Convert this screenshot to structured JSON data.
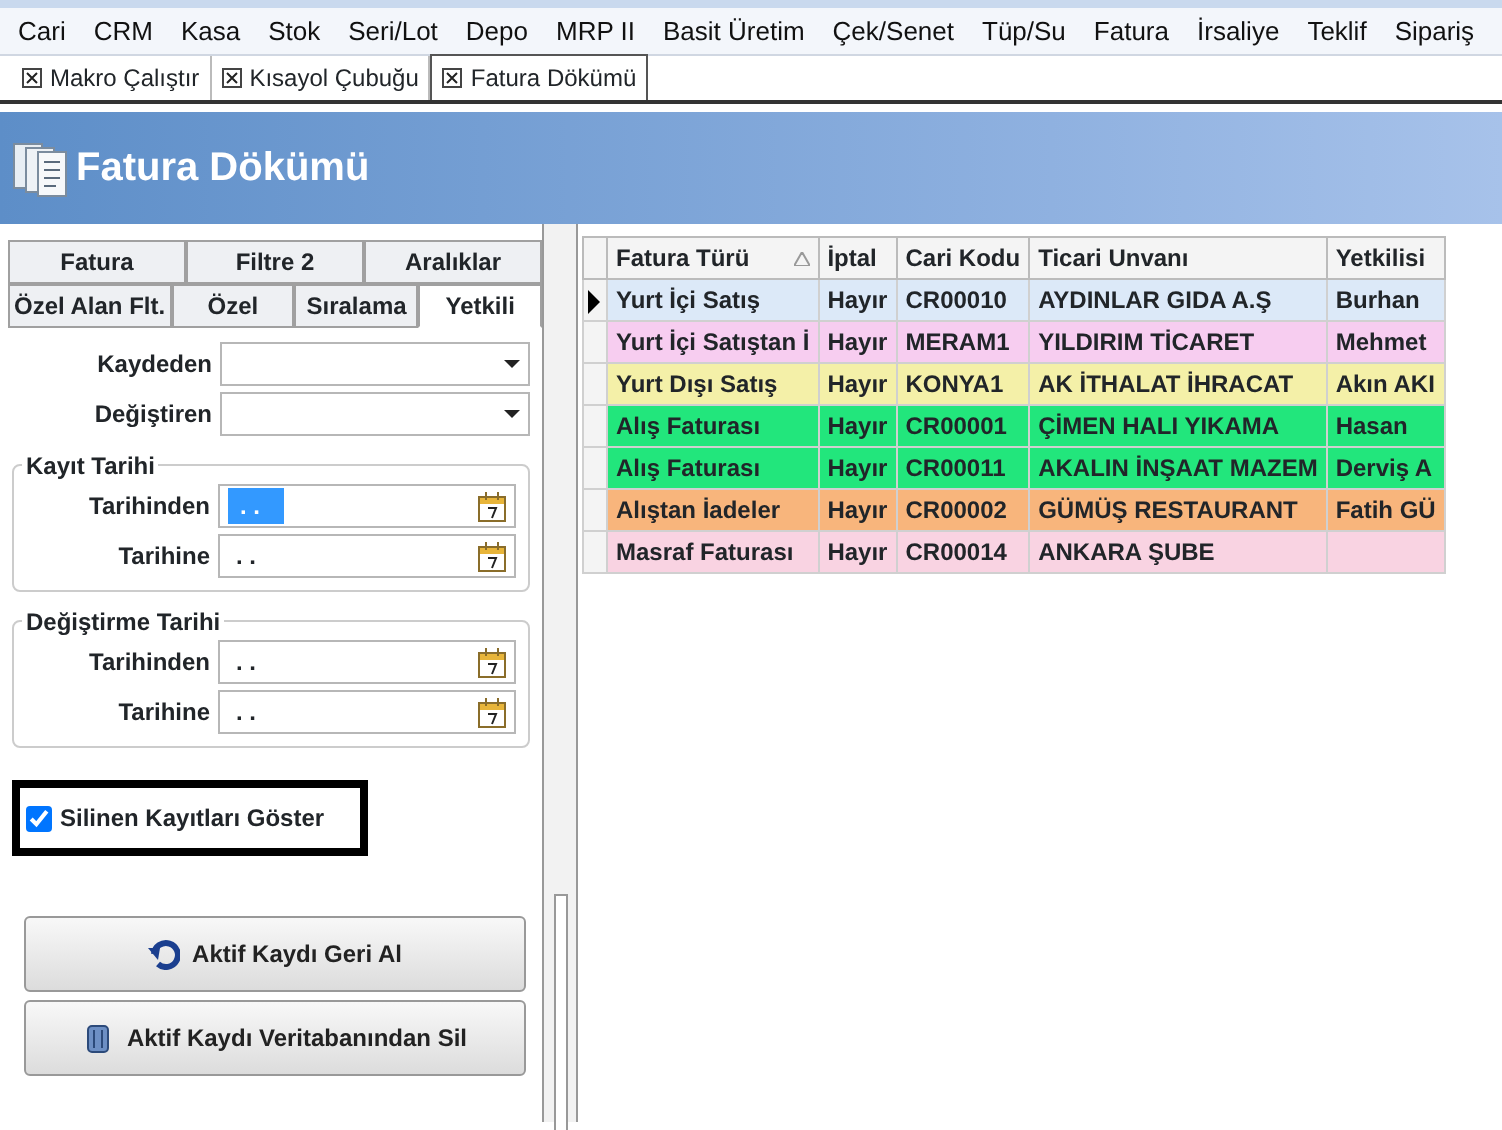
{
  "menu": [
    "Cari",
    "CRM",
    "Kasa",
    "Stok",
    "Seri/Lot",
    "Depo",
    "MRP II",
    "Basit Üretim",
    "Çek/Senet",
    "Tüp/Su",
    "Fatura",
    "İrsaliye",
    "Teklif",
    "Sipariş"
  ],
  "doc_tabs": [
    {
      "label": "Makro Çalıştır",
      "selected": false
    },
    {
      "label": "Kısayol Çubuğu",
      "selected": false
    },
    {
      "label": "Fatura Dökümü",
      "selected": true
    }
  ],
  "header": {
    "title": "Fatura Dökümü"
  },
  "filter_tabs": [
    [
      {
        "label": "Fatura",
        "selected": false
      },
      {
        "label": "Filtre 2",
        "selected": false
      },
      {
        "label": "Aralıklar",
        "selected": false
      }
    ],
    [
      {
        "label": "Özel Alan Flt.",
        "selected": false
      },
      {
        "label": "Özel",
        "selected": false
      },
      {
        "label": "Sıralama",
        "selected": false
      },
      {
        "label": "Yetkili",
        "selected": true
      }
    ]
  ],
  "dropdowns": [
    {
      "label": "Kaydeden"
    },
    {
      "label": "Değiştiren"
    }
  ],
  "date_groups": [
    {
      "title": "Kayıt Tarihi",
      "fields": [
        {
          "label": "Tarihinden",
          "value": ". .",
          "focused": true
        },
        {
          "label": "Tarihine",
          "value": ". .",
          "focused": false
        }
      ]
    },
    {
      "title": "Değiştirme Tarihi",
      "fields": [
        {
          "label": "Tarihinden",
          "value": ". .",
          "focused": false
        },
        {
          "label": "Tarihine",
          "value": ". .",
          "focused": false
        }
      ]
    }
  ],
  "show_deleted": {
    "label": "Silinen Kayıtları Göster",
    "checked": true
  },
  "buttons": [
    {
      "label": "Aktif Kaydı Geri Al",
      "kind": "undo"
    },
    {
      "label": "Aktif Kaydı Veritabanından Sil",
      "kind": "delete"
    }
  ],
  "table": {
    "columns": [
      {
        "label": "Fatura Türü",
        "sorted": true
      },
      {
        "label": "İptal",
        "sorted": false
      },
      {
        "label": "Cari Kodu",
        "sorted": false
      },
      {
        "label": "Ticari Unvanı",
        "sorted": false
      },
      {
        "label": "Yetkilisi",
        "sorted": false
      }
    ],
    "rows": [
      {
        "cells": [
          "Yurt İçi Satış",
          "Hayır",
          "CR00010",
          "AYDINLAR GIDA A.Ş",
          "Burhan"
        ],
        "color": "#dce9f8",
        "selected": true
      },
      {
        "cells": [
          "Yurt İçi Satıştan İ",
          "Hayır",
          "MERAM1",
          "YILDIRIM TİCARET",
          "Mehmet"
        ],
        "color": "#f7cdf0",
        "selected": false
      },
      {
        "cells": [
          "Yurt Dışı Satış",
          "Hayır",
          "KONYA1",
          "AK İTHALAT İHRACAT",
          "Akın AKI"
        ],
        "color": "#f4f0a8",
        "selected": false
      },
      {
        "cells": [
          "Alış Faturası",
          "Hayır",
          "CR00001",
          "ÇİMEN HALI YIKAMA",
          "Hasan"
        ],
        "color": "#22e67c",
        "selected": false
      },
      {
        "cells": [
          "Alış Faturası",
          "Hayır",
          "CR00011",
          "AKALIN İNŞAAT MAZEM",
          "Derviş A"
        ],
        "color": "#22e67c",
        "selected": false
      },
      {
        "cells": [
          "Alıştan İadeler",
          "Hayır",
          "CR00002",
          "GÜMÜŞ RESTAURANT",
          "Fatih GÜ"
        ],
        "color": "#f8b57c",
        "selected": false
      },
      {
        "cells": [
          "Masraf Faturası",
          "Hayır",
          "CR00014",
          "ANKARA ŞUBE",
          ""
        ],
        "color": "#f9d3e2",
        "selected": false
      }
    ]
  }
}
